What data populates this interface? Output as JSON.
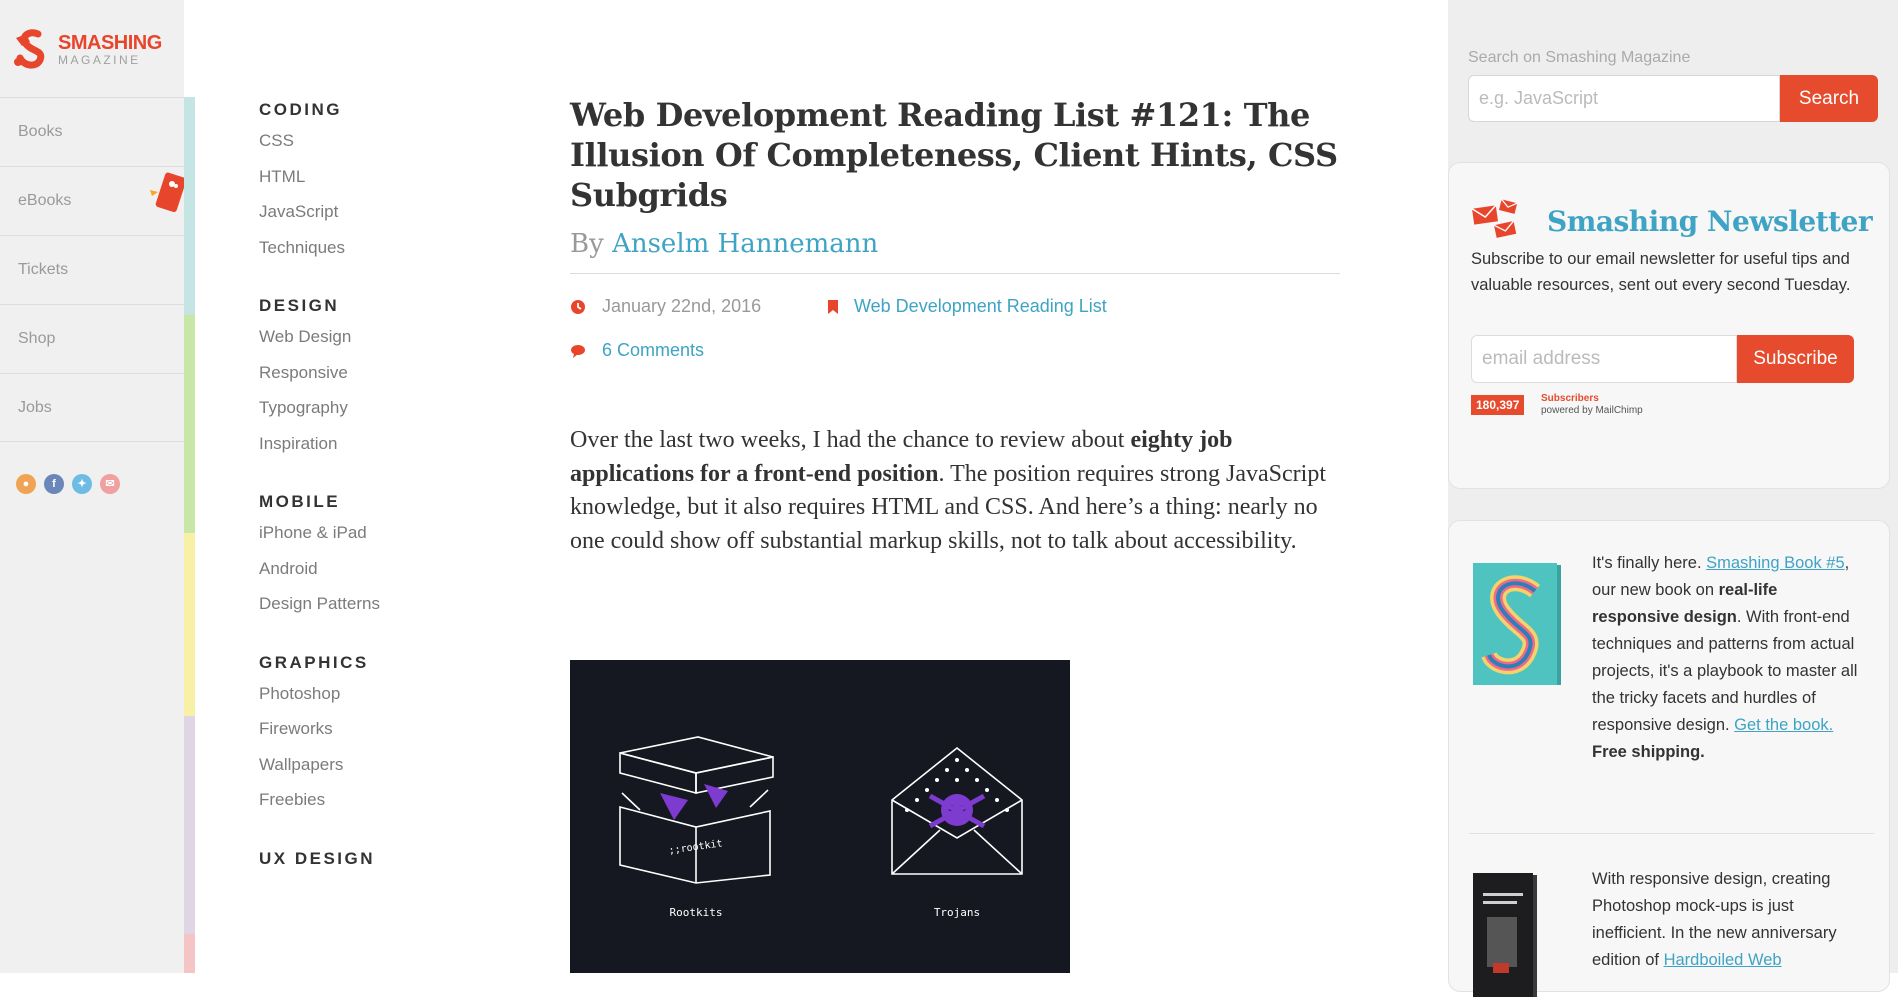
{
  "brand": {
    "name_line1": "SMASHING",
    "name_line2": "MAGAZINE"
  },
  "left_nav": {
    "items": [
      {
        "label": "Books"
      },
      {
        "label": "eBooks"
      },
      {
        "label": "Tickets"
      },
      {
        "label": "Shop"
      },
      {
        "label": "Jobs"
      }
    ],
    "social": [
      {
        "icon": "rss-icon",
        "glyph": "",
        "color": "#f0a355"
      },
      {
        "icon": "facebook-icon",
        "glyph": "f",
        "color": "#6b86b8"
      },
      {
        "icon": "twitter-icon",
        "glyph": "",
        "color": "#6cbce4"
      },
      {
        "icon": "email-icon",
        "glyph": "",
        "color": "#f0a0a0"
      }
    ],
    "strip_colors": [
      "#c5e5e5",
      "#c8e6a5",
      "#f8f0a5",
      "#e0d5e5",
      "#f5c5c5"
    ]
  },
  "categories": {
    "coding": {
      "title": "CODING",
      "links": [
        "CSS",
        "HTML",
        "JavaScript",
        "Techniques"
      ]
    },
    "design": {
      "title": "DESIGN",
      "links": [
        "Web Design",
        "Responsive",
        "Typography",
        "Inspiration"
      ]
    },
    "mobile": {
      "title": "MOBILE",
      "links": [
        "iPhone & iPad",
        "Android",
        "Design Patterns"
      ]
    },
    "graphics": {
      "title": "GRAPHICS",
      "links": [
        "Photoshop",
        "Fireworks",
        "Wallpapers",
        "Freebies"
      ]
    },
    "ux": {
      "title": "UX DESIGN"
    }
  },
  "article": {
    "title": "Web Development Reading List #121: The Illusion Of Completeness, Client Hints, CSS Subgrids",
    "by": "By",
    "author": "Anselm Hannemann",
    "date": "January 22nd, 2016",
    "category": "Web Development Reading List",
    "comments": "6 Comments",
    "lead_1": "Over the last two weeks, I had the chance to review about ",
    "lead_bold": "eighty job applications for a front-end position",
    "lead_2": ". The position requires strong JavaScript knowledge, but it also requires HTML and CSS. And here’s a thing: nearly no one could show off substantial markup skills, not to talk about accessibility.",
    "figure": {
      "box_label": ";;rootkit",
      "caption_left": "Rootkits",
      "caption_right": "Trojans"
    }
  },
  "sidebar": {
    "search": {
      "label": "Search on Smashing Magazine",
      "placeholder": "e.g. JavaScript",
      "button": "Search"
    },
    "newsletter": {
      "title": "Smashing Newsletter",
      "text": "Subscribe to our email newsletter for useful tips and valuable resources, sent out every second Tuesday.",
      "placeholder": "email address",
      "button": "Subscribe",
      "count": "180,397",
      "count_label": "Subscribers",
      "powered": "powered by MailChimp"
    },
    "promo1": {
      "t1": "It's finally here. ",
      "link1": "Smashing Book #5",
      "t2": ", our new book on ",
      "bold1": "real-life responsive design",
      "t3": ". With front-end techniques and patterns from actual projects, it's a playbook to master all the tricky facets and hurdles of responsive design. ",
      "link2": "Get the book.",
      "bold2": " Free shipping."
    },
    "promo2": {
      "t1": "With responsive design, creating Photoshop mock-ups is just inefficient. In the new anniversary edition of ",
      "link1": "Hardboiled Web"
    }
  }
}
